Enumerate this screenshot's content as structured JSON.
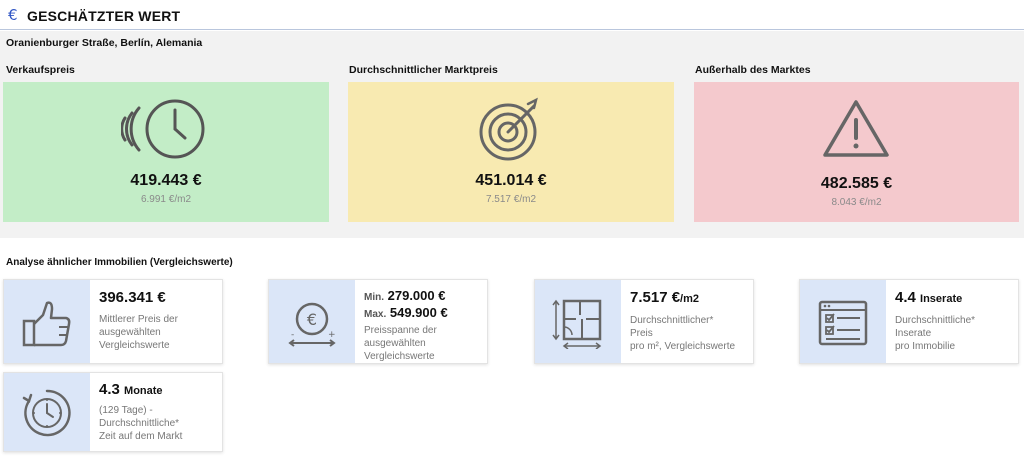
{
  "header": {
    "icon": "euro-icon",
    "euro_symbol": "€",
    "title": "GESCHÄTZTER WERT",
    "accent": "#2f55c4"
  },
  "address": "Oranienburger Straße, Berlín, Alemania",
  "prices": [
    {
      "label": "Verkaufspreis",
      "price": "419.443 €",
      "per_sqm": "6.991 €/m2",
      "color": "#c3edc7",
      "icon": "fast-clock-icon"
    },
    {
      "label": "Durchschnittlicher Marktpreis",
      "price": "451.014 €",
      "per_sqm": "7.517 €/m2",
      "color": "#f8eab1",
      "icon": "target-icon"
    },
    {
      "label": "Außerhalb des Marktes",
      "price": "482.585 €",
      "per_sqm": "8.043 €/m2",
      "color": "#f4c9cd",
      "icon": "warning-icon"
    }
  ],
  "analysis": {
    "title": "Analyse ähnlicher Immobilien (Vergleichswerte)",
    "cards": [
      {
        "icon": "thumbs-up-icon",
        "value": "396.341 €",
        "desc": [
          "Mittlerer Preis der",
          "ausgewählten",
          "Vergleichswerte"
        ]
      },
      {
        "icon": "euro-range-icon",
        "min_label": "Min.",
        "min_value": "279.000 €",
        "max_label": "Max.",
        "max_value": "549.900 €",
        "desc": [
          "Preisspanne der",
          "ausgewählten",
          "Vergleichswerte"
        ]
      },
      {
        "icon": "floor-plan-icon",
        "value": "7.517 €",
        "unit": "/m2",
        "desc": [
          "Durchschnittlicher*",
          "Preis",
          "pro m², Vergleichswerte"
        ]
      },
      {
        "icon": "listings-icon",
        "value": "4.4",
        "unit": "Inserate",
        "desc": [
          "Durchschnittliche*",
          "Inserate",
          "pro Immobilie"
        ]
      },
      {
        "icon": "time-on-market-icon",
        "value": "4.3",
        "unit": "Monate",
        "desc": [
          "(129 Tage) -",
          "Durchschnittliche*",
          "Zeit auf dem Markt"
        ]
      }
    ]
  }
}
